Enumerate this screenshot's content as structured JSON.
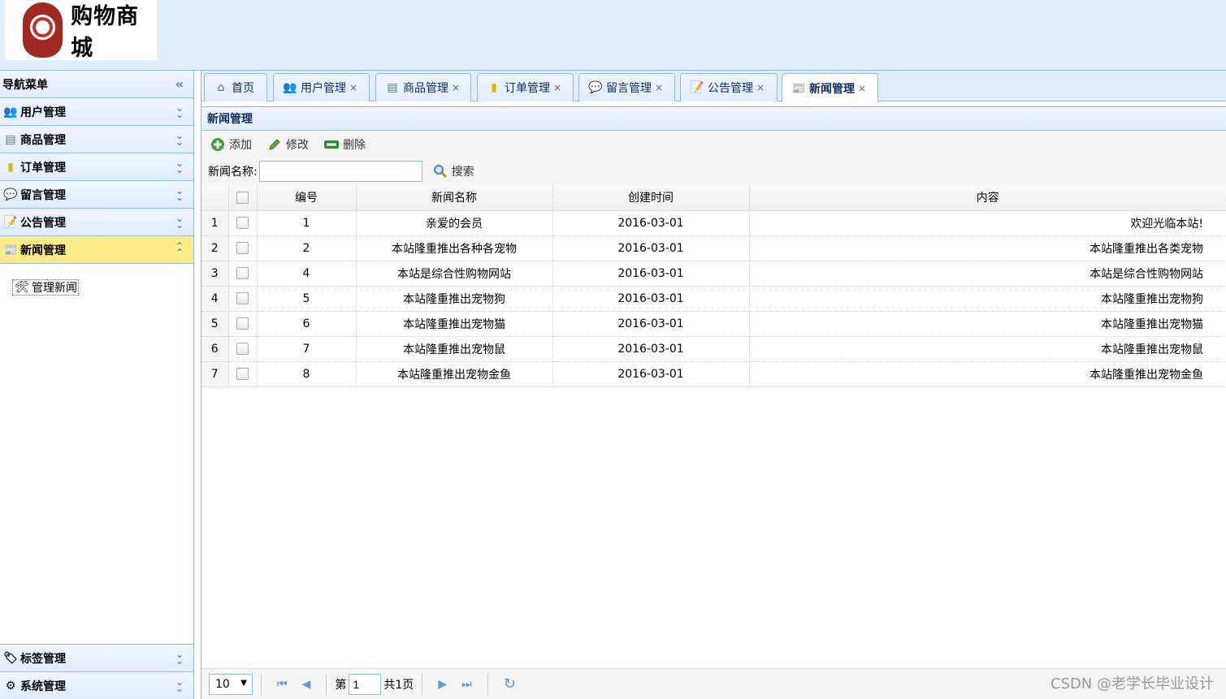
{
  "logo": {
    "text": "购物商城"
  },
  "sidebar": {
    "title": "导航菜单",
    "menus": [
      {
        "label": "用户管理",
        "icon": "users-icon"
      },
      {
        "label": "商品管理",
        "icon": "list-icon"
      },
      {
        "label": "订单管理",
        "icon": "folder-icon"
      },
      {
        "label": "留言管理",
        "icon": "speech-bubble-icon"
      },
      {
        "label": "公告管理",
        "icon": "notepad-icon"
      },
      {
        "label": "新闻管理",
        "icon": "news-icon"
      }
    ],
    "active_item": "管理新闻",
    "bottom_menus": [
      {
        "label": "标签管理",
        "icon": "tag-icon"
      },
      {
        "label": "系统管理",
        "icon": "gear-icon"
      }
    ]
  },
  "tabs": [
    {
      "label": "首页",
      "icon": "home-icon",
      "closable": false
    },
    {
      "label": "用户管理",
      "icon": "users-icon",
      "closable": true
    },
    {
      "label": "商品管理",
      "icon": "list-icon",
      "closable": true
    },
    {
      "label": "订单管理",
      "icon": "folder-icon",
      "closable": true
    },
    {
      "label": "留言管理",
      "icon": "speech-bubble-icon",
      "closable": true
    },
    {
      "label": "公告管理",
      "icon": "notepad-icon",
      "closable": true
    },
    {
      "label": "新闻管理",
      "icon": "news-icon",
      "closable": true
    }
  ],
  "close_glyph": "×",
  "panel": {
    "title": "新闻管理"
  },
  "toolbar": {
    "add": "添加",
    "edit": "修改",
    "delete": "删除"
  },
  "search": {
    "label": "新闻名称:",
    "value": "",
    "button": "搜索"
  },
  "table": {
    "headers": {
      "id": "编号",
      "name": "新闻名称",
      "created": "创建时间",
      "content": "内容"
    },
    "rows": [
      {
        "rownum": "1",
        "id": "1",
        "name": "亲爱的会员",
        "created": "2016-03-01",
        "content": "欢迎光临本站!"
      },
      {
        "rownum": "2",
        "id": "2",
        "name": "本站隆重推出各种各宠物",
        "created": "2016-03-01",
        "content": "本站隆重推出各类宠物"
      },
      {
        "rownum": "3",
        "id": "4",
        "name": "本站是综合性购物网站",
        "created": "2016-03-01",
        "content": "本站是综合性购物网站"
      },
      {
        "rownum": "4",
        "id": "5",
        "name": "本站隆重推出宠物狗",
        "created": "2016-03-01",
        "content": "本站隆重推出宠物狗"
      },
      {
        "rownum": "5",
        "id": "6",
        "name": "本站隆重推出宠物猫",
        "created": "2016-03-01",
        "content": "本站隆重推出宠物猫"
      },
      {
        "rownum": "6",
        "id": "7",
        "name": "本站隆重推出宠物鼠",
        "created": "2016-03-01",
        "content": "本站隆重推出宠物鼠"
      },
      {
        "rownum": "7",
        "id": "8",
        "name": "本站隆重推出宠物金鱼",
        "created": "2016-03-01",
        "content": "本站隆重推出宠物金鱼"
      }
    ]
  },
  "pager": {
    "page_size": "10",
    "page_prefix": "第",
    "page_value": "1",
    "page_total": "共1页"
  },
  "watermark": "CSDN @老学长毕业设计",
  "colors": {
    "accent": "#95b8e7",
    "header_bg": "#e0ecff",
    "active_menu": "#fbec88"
  }
}
